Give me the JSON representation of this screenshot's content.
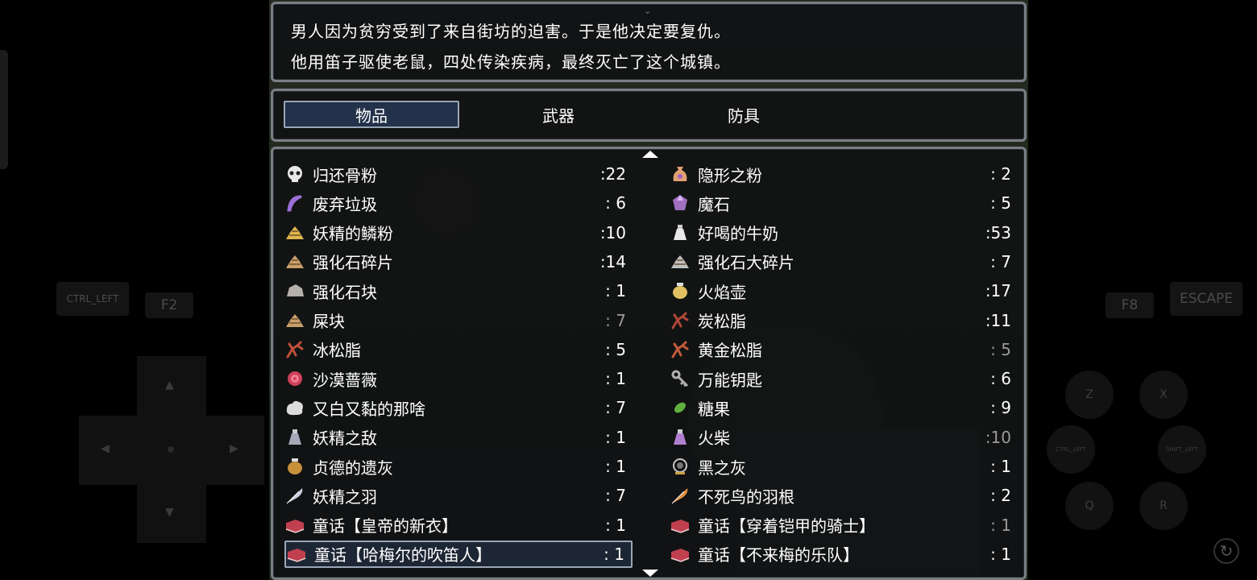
{
  "controls": {
    "ctrl_left": "CTRL_LEFT",
    "f2": "F2",
    "f8": "F8",
    "escape": "ESCAPE",
    "btn_z": "Z",
    "btn_x": "X",
    "btn_ctrl_left": "CTRL_LEFT",
    "btn_shift_left": "SHIFT_LEFT",
    "btn_q": "Q",
    "btn_r": "R",
    "dpad_up": "▲",
    "dpad_down": "▼",
    "dpad_left": "◀",
    "dpad_right": "▶",
    "refresh": "↻"
  },
  "help": {
    "line1": "男人因为贫穷受到了来自街坊的迫害。于是他决定要复仇。",
    "line2": "他用笛子驱使老鼠，四处传染疾病，最终灭亡了这个城镇。"
  },
  "tabs": [
    {
      "label": "物品",
      "active": true
    },
    {
      "label": "武器",
      "active": false
    },
    {
      "label": "防具",
      "active": false
    }
  ],
  "items_left": [
    {
      "name": "归还骨粉",
      "count": ":22",
      "icon": "skull-icon",
      "color": "#e8e8e8"
    },
    {
      "name": "废弃垃圾",
      "count": ": 6",
      "icon": "ribbon-icon",
      "color": "#9b6fd6"
    },
    {
      "name": "妖精的鳞粉",
      "count": ":10",
      "icon": "powder-icon",
      "color": "#e0b54a"
    },
    {
      "name": "强化石碎片",
      "count": ":14",
      "icon": "ore-pile-icon",
      "color": "#c9a06a"
    },
    {
      "name": "强化石块",
      "count": ": 1",
      "icon": "stone-icon",
      "color": "#b5b0aa"
    },
    {
      "name": "屎块",
      "count": ": 7",
      "icon": "dung-icon",
      "color": "#c9a06a",
      "dim": true
    },
    {
      "name": "冰松脂",
      "count": ": 5",
      "icon": "coral-icon",
      "color": "#c0503a"
    },
    {
      "name": "沙漠蔷薇",
      "count": ": 1",
      "icon": "rose-icon",
      "color": "#d0405a"
    },
    {
      "name": "又白又黏的那啥",
      "count": ": 7",
      "icon": "blob-icon",
      "color": "#dcdcdc"
    },
    {
      "name": "妖精之敌",
      "count": ": 1",
      "icon": "vial-icon",
      "color": "#a8a8b8"
    },
    {
      "name": "贞德的遗灰",
      "count": ": 1",
      "icon": "urn-icon",
      "color": "#c8903a"
    },
    {
      "name": "妖精之羽",
      "count": ": 7",
      "icon": "feather-icon",
      "color": "#c8d0e0"
    },
    {
      "name": "童话【皇帝的新衣】",
      "count": ": 1",
      "icon": "book-icon",
      "color": "#c04050"
    },
    {
      "name": "童话【哈梅尔的吹笛人】",
      "count": ": 1",
      "icon": "book-icon",
      "color": "#c04050",
      "selected": true
    }
  ],
  "items_right": [
    {
      "name": "隐形之粉",
      "count": ": 2",
      "icon": "pouch-icon",
      "color": "#e0a070"
    },
    {
      "name": "魔石",
      "count": ": 5",
      "icon": "gem-icon",
      "color": "#a070c0"
    },
    {
      "name": "好喝的牛奶",
      "count": ":53",
      "icon": "milk-bottle-icon",
      "color": "#e8e8e8"
    },
    {
      "name": "强化石大碎片",
      "count": ": 7",
      "icon": "ore-large-icon",
      "color": "#c0c0c0"
    },
    {
      "name": "火焰壶",
      "count": ":17",
      "icon": "fire-pot-icon",
      "color": "#e0c060"
    },
    {
      "name": "炭松脂",
      "count": ":11",
      "icon": "coral-icon",
      "color": "#b04838"
    },
    {
      "name": "黄金松脂",
      "count": ": 5",
      "icon": "coral-icon",
      "color": "#c05a3a",
      "dim": true
    },
    {
      "name": "万能钥匙",
      "count": ": 6",
      "icon": "key-icon",
      "color": "#b0b0b0"
    },
    {
      "name": "糖果",
      "count": ": 9",
      "icon": "candy-icon",
      "color": "#60b040"
    },
    {
      "name": "火柴",
      "count": ":10",
      "icon": "potion-icon",
      "color": "#b080d0",
      "dim": true
    },
    {
      "name": "黑之灰",
      "count": ": 1",
      "icon": "orb-icon",
      "color": "#c8c8c8"
    },
    {
      "name": "不死鸟的羽根",
      "count": ": 2",
      "icon": "phoenix-feather-icon",
      "color": "#e09040"
    },
    {
      "name": "童话【穿着铠甲的骑士】",
      "count": ": 1",
      "icon": "book-icon",
      "color": "#c04050",
      "dim": true
    },
    {
      "name": "童话【不来梅的乐队】",
      "count": ": 1",
      "icon": "book-icon",
      "color": "#c04050"
    }
  ]
}
